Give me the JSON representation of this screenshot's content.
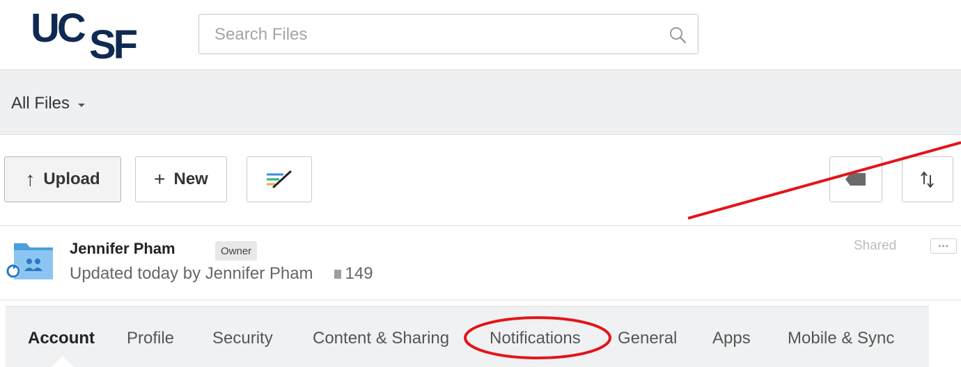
{
  "header": {
    "logo_text": "UCSF",
    "search": {
      "placeholder": "Search Files",
      "value": ""
    }
  },
  "breadcrumb": {
    "label": "All Files"
  },
  "toolbar": {
    "upload_label": "Upload",
    "new_label": "New"
  },
  "folder": {
    "name": "Jennifer Pham",
    "badge": "Owner",
    "updated": "Updated today by Jennifer Pham",
    "file_count": "149",
    "status": "Shared"
  },
  "tabs": [
    {
      "label": "Account",
      "active": true
    },
    {
      "label": "Profile"
    },
    {
      "label": "Security"
    },
    {
      "label": "Content & Sharing"
    },
    {
      "label": "Notifications",
      "highlighted": true
    },
    {
      "label": "General"
    },
    {
      "label": "Apps"
    },
    {
      "label": "Mobile & Sync"
    }
  ],
  "colors": {
    "brand": "#0f2a52",
    "annotation": "#e3141a",
    "folder_blue": "#4a9fe0"
  }
}
